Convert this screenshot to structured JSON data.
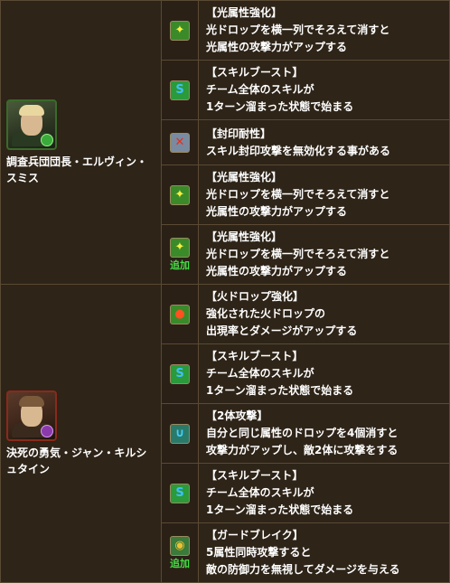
{
  "characters": [
    {
      "name": "調査兵団団長・エルヴィン・スミス",
      "portrait_icon": "erwin-portrait-icon",
      "awakenings": [
        {
          "icon": "light-drop-enhance-icon",
          "title": "【光属性強化】",
          "lines": [
            "光ドロップを横一列でそろえて消すと",
            "光属性の攻撃力がアップする"
          ]
        },
        {
          "icon": "skill-boost-icon",
          "title": "【スキルブースト】",
          "lines": [
            "チーム全体のスキルが",
            "1ターン溜まった状態で始まる"
          ]
        },
        {
          "icon": "seal-resist-icon",
          "title": "【封印耐性】",
          "lines": [
            "スキル封印攻撃を無効化する事がある"
          ]
        },
        {
          "icon": "light-drop-enhance-icon",
          "title": "【光属性強化】",
          "lines": [
            "光ドロップを横一列でそろえて消すと",
            "光属性の攻撃力がアップする"
          ]
        },
        {
          "icon": "light-drop-enhance-icon",
          "title": "【光属性強化】",
          "lines": [
            "光ドロップを横一列でそろえて消すと",
            "光属性の攻撃力がアップする"
          ],
          "added": "追加"
        }
      ]
    },
    {
      "name": "決死の勇気・ジャン・キルシュタイン",
      "portrait_icon": "jean-portrait-icon",
      "awakenings": [
        {
          "icon": "fire-drop-enhance-icon",
          "title": "【火ドロップ強化】",
          "lines": [
            "強化された火ドロップの",
            "出現率とダメージがアップする"
          ]
        },
        {
          "icon": "skill-boost-icon",
          "title": "【スキルブースト】",
          "lines": [
            "チーム全体のスキルが",
            "1ターン溜まった状態で始まる"
          ]
        },
        {
          "icon": "two-prong-attack-icon",
          "title": "【2体攻撃】",
          "lines": [
            "自分と同じ属性のドロップを4個消すと",
            "攻撃力がアップし、敵2体に攻撃をする"
          ]
        },
        {
          "icon": "skill-boost-icon",
          "title": "【スキルブースト】",
          "lines": [
            "チーム全体のスキルが",
            "1ターン溜まった状態で始まる"
          ]
        },
        {
          "icon": "guard-break-icon",
          "title": "【ガードブレイク】",
          "lines": [
            "5属性同時攻撃すると",
            "敵の防御力を無視してダメージを与える"
          ],
          "added": "追加"
        }
      ]
    }
  ]
}
